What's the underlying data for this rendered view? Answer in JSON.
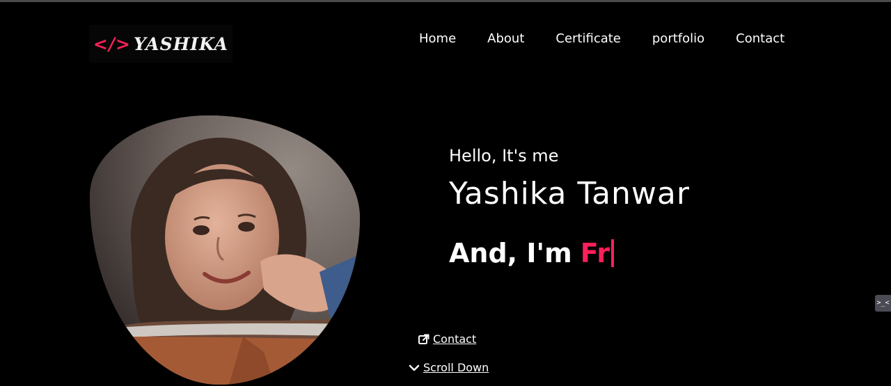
{
  "logo": {
    "code": "</>",
    "name": "YASHIKA"
  },
  "nav": [
    "Home",
    "About",
    "Certificate",
    "portfolio",
    "Contact"
  ],
  "hero": {
    "greeting": "Hello, It's me",
    "name": "Yashika Tanwar",
    "role_prefix": "And, I'm",
    "role_typed": "Fr"
  },
  "links": {
    "contact": "Contact",
    "scroll": "Scroll Down"
  },
  "widget": {
    "label": ">_<"
  },
  "colors": {
    "accent": "#ff1f5a",
    "background": "#000000",
    "text": "#ffffff"
  },
  "icons": [
    "external-link-icon",
    "chevron-down-icon"
  ]
}
